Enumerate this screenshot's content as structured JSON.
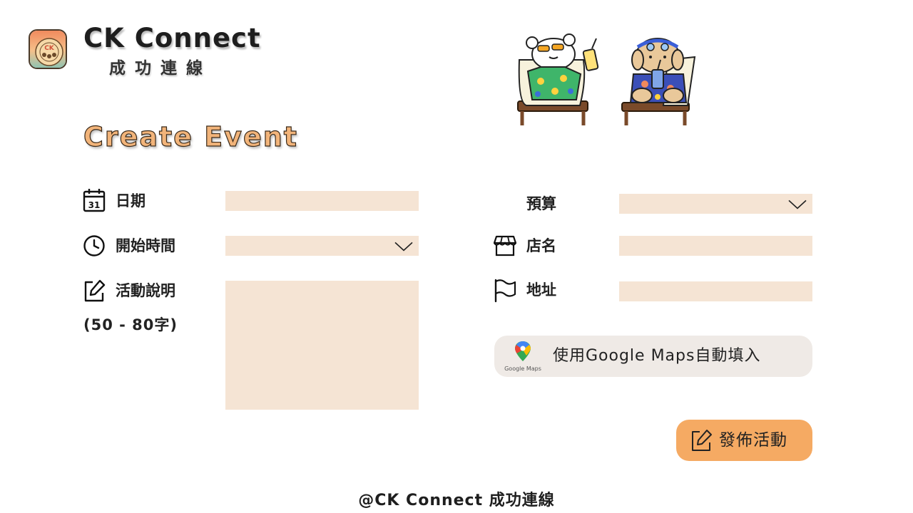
{
  "brand": {
    "title": "CK Connect",
    "subtitle": "成功連線",
    "logo_text": "CK"
  },
  "page": {
    "title": "Create Event"
  },
  "form": {
    "date": {
      "label": "日期",
      "value": ""
    },
    "start_time": {
      "label": "開始時間",
      "value": ""
    },
    "description": {
      "label": "活動說明",
      "hint": "(50 - 80字)",
      "value": ""
    },
    "budget": {
      "label": "預算",
      "value": ""
    },
    "store_name": {
      "label": "店名",
      "value": ""
    },
    "address": {
      "label": "地址",
      "value": ""
    }
  },
  "calendar_icon_day": "31",
  "maps_button": {
    "label": "使用Google Maps自動填入",
    "logo_caption": "Google Maps"
  },
  "publish_button": {
    "label": "發佈活動"
  },
  "footer": {
    "text": "@CK Connect 成功連線"
  },
  "colors": {
    "accent": "#f5aa63",
    "field_bg": "#f5e4d4",
    "maps_button_bg": "#efeae6",
    "title_fill": "#f2b47a"
  }
}
